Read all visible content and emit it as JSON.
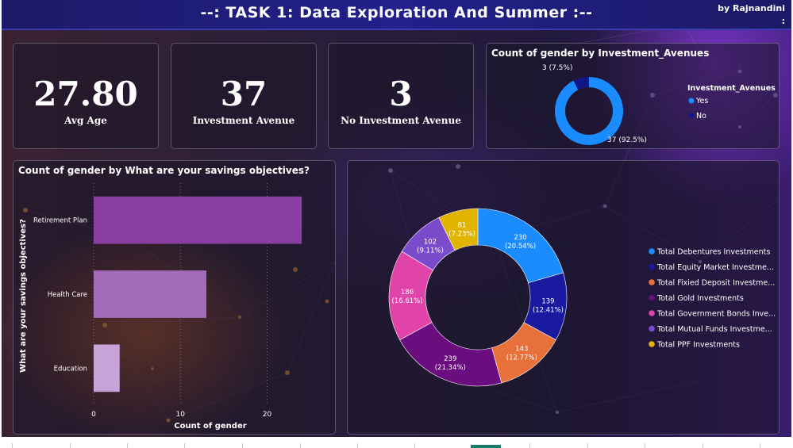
{
  "header": {
    "title": "--: TASK 1: Data Exploration And Summer :--",
    "byline": "by Rajnandini",
    "byline_mark": ":"
  },
  "kpis": [
    {
      "value": "27.80",
      "label": "Avg Age"
    },
    {
      "value": "37",
      "label": "Investment Avenue"
    },
    {
      "value": "3",
      "label": "No Investment Avenue"
    }
  ],
  "colors": {
    "yes": "#1a8cff",
    "no": "#15158a",
    "bar1": "#8a3ea2",
    "bar2": "#a36cbb",
    "bar3": "#c8a3d8"
  },
  "chart_data": [
    {
      "type": "pie",
      "title": "Count of gender by Investment_Avenues",
      "legend_title": "Investment_Avenues",
      "legend_placement": "right",
      "donut": true,
      "slices": [
        {
          "label": "Yes",
          "value": 37,
          "data_label": "37 (92.5%)",
          "color": "#1a8cff"
        },
        {
          "label": "No",
          "value": 3,
          "data_label": "3 (7.5%)",
          "color": "#15158a"
        }
      ]
    },
    {
      "type": "bar",
      "orientation": "horizontal",
      "title": "Count of gender by What are your savings objectives?",
      "xlabel": "Count of gender",
      "ylabel": "What are your savings objectives?",
      "categories": [
        "Retirement Plan",
        "Health Care",
        "Education"
      ],
      "values": [
        24,
        13,
        3
      ],
      "xticks": [
        "0",
        "10",
        "20"
      ],
      "xlim": [
        0,
        26
      ],
      "grid": "vertical dotted"
    },
    {
      "type": "pie",
      "donut": true,
      "legend_placement": "right",
      "slices": [
        {
          "label": "Total Debentures Investments",
          "legend": "Total Debentures Investments",
          "value": 230,
          "pct": "(20.54%)",
          "color": "#1a8cff"
        },
        {
          "label": "Total Equity Market Investments",
          "legend": "Total Equity Market Investme...",
          "value": 139,
          "pct": "(12.41%)",
          "color": "#1a1aa0"
        },
        {
          "label": "Total Fixied Deposit Investments",
          "legend": "Total Fixied Deposit Investme...",
          "value": 143,
          "pct": "(12.77%)",
          "color": "#e8703a"
        },
        {
          "label": "Total Gold Investments",
          "legend": "Total Gold Investments",
          "value": 239,
          "pct": "(21.34%)",
          "color": "#6a0d7e"
        },
        {
          "label": "Total Government Bonds Investments",
          "legend": "Total Government Bonds Inve...",
          "value": 186,
          "pct": "(16.61%)",
          "color": "#e044a8"
        },
        {
          "label": "Total Mutual Funds Investments",
          "legend": "Total Mutual Funds Investme...",
          "value": 102,
          "pct": "(9.11%)",
          "color": "#7a4ccc"
        },
        {
          "label": "Total PPF Investments",
          "legend": "Total PPF Investments",
          "value": 81,
          "pct": "(7.23%)",
          "color": "#e0b400"
        }
      ]
    }
  ]
}
